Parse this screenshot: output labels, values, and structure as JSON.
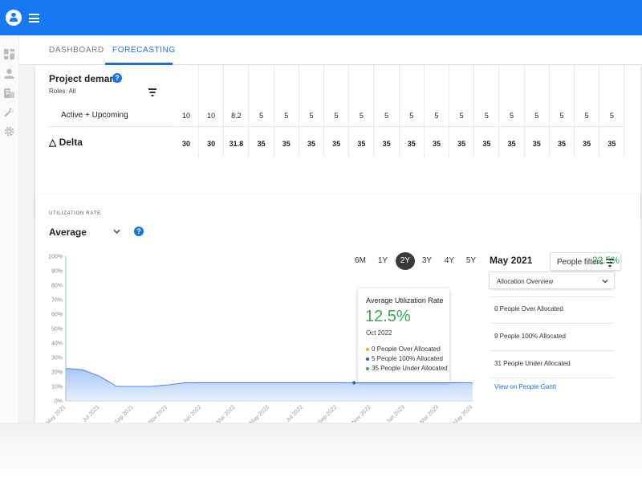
{
  "nav": {
    "tabs": [
      {
        "label": "DASHBOARD",
        "active": false
      },
      {
        "label": "FORECASTING",
        "active": true
      }
    ],
    "sidebar_icons": [
      "dashboard-icon",
      "person-icon",
      "building-icon",
      "wrench-icon",
      "gear-icon"
    ]
  },
  "demand": {
    "title": "Project demand",
    "roles": "Roles: All",
    "rows": [
      {
        "label": "Active + Upcoming",
        "values": [
          "10",
          "10",
          "8.2",
          "5",
          "5",
          "5",
          "5",
          "5",
          "5",
          "5",
          "5",
          "5",
          "5",
          "5",
          "5",
          "5",
          "5",
          "5"
        ]
      },
      {
        "label": "△ Delta",
        "values": [
          "30",
          "30",
          "31.8",
          "35",
          "35",
          "35",
          "35",
          "35",
          "35",
          "35",
          "35",
          "35",
          "35",
          "35",
          "35",
          "35",
          "35",
          "35"
        ]
      }
    ]
  },
  "utilization": {
    "section_label": "UTILIZATION RATE",
    "mode": "Average",
    "periods": [
      {
        "label": "6M",
        "active": false
      },
      {
        "label": "1Y",
        "active": false
      },
      {
        "label": "2Y",
        "active": true
      },
      {
        "label": "3Y",
        "active": false
      },
      {
        "label": "4Y",
        "active": false
      },
      {
        "label": "5Y",
        "active": false
      }
    ],
    "filters_label": "People filters"
  },
  "chart_data": {
    "type": "area",
    "title": "",
    "xlabel": "",
    "ylabel": "",
    "y_ticks": [
      "0%",
      "10%",
      "20%",
      "30%",
      "40%",
      "50%",
      "60%",
      "70%",
      "80%",
      "90%",
      "100%"
    ],
    "ylim": [
      0,
      100
    ],
    "x_ticks": [
      "May 2021",
      "Jul 2021",
      "Sep 2021",
      "Nov 2021",
      "Jan 2022",
      "Mar 2022",
      "May 2022",
      "Jul 2022",
      "Sep 2022",
      "Nov 2022",
      "Jan 2023",
      "Mar 2023",
      "May 2023"
    ],
    "x": [
      "May 2021",
      "Jun 2021",
      "Jul 2021",
      "Aug 2021",
      "Sep 2021",
      "Oct 2021",
      "Nov 2021",
      "Dec 2021",
      "Jan 2022",
      "Feb 2022",
      "Mar 2022",
      "Apr 2022",
      "May 2022",
      "Jun 2022",
      "Jul 2022",
      "Aug 2022",
      "Sep 2022",
      "Oct 2022",
      "Nov 2022",
      "Dec 2022",
      "Jan 2023",
      "Feb 2023",
      "Mar 2023",
      "Apr 2023",
      "May 2023"
    ],
    "series": [
      {
        "values": [
          22.5,
          21.5,
          17,
          10,
          10,
          10,
          11,
          12.5,
          12.5,
          12.5,
          12.5,
          12.5,
          12.5,
          12.5,
          12.5,
          12.5,
          12.5,
          12.5,
          12.5,
          12.5,
          12.5,
          12.5,
          12.5,
          12.5,
          12.5
        ]
      }
    ],
    "grid": false,
    "color": "#4a86e8"
  },
  "tooltip": {
    "title": "Average Utilization Rate",
    "value": "12.5%",
    "date": "Oct 2022",
    "items": [
      {
        "text": "0 People Over Allocated",
        "color": "#f0a33a"
      },
      {
        "text": "5 People 100% Allocated",
        "color": "#1f5fbf"
      },
      {
        "text": "35 People Under Allocated",
        "color": "#34a853"
      }
    ]
  },
  "summary": {
    "month": "May 2021",
    "rate": "22.5%",
    "dropdown": "Allocation Overview",
    "rows": [
      "0 People Over Allocated",
      "9 People 100% Allocated",
      "31 People Under Allocated"
    ],
    "link": "View on People Gantt"
  },
  "colors": {
    "brand": "#1778f2",
    "accent": "#1b6fd8",
    "positive": "#34a853"
  }
}
